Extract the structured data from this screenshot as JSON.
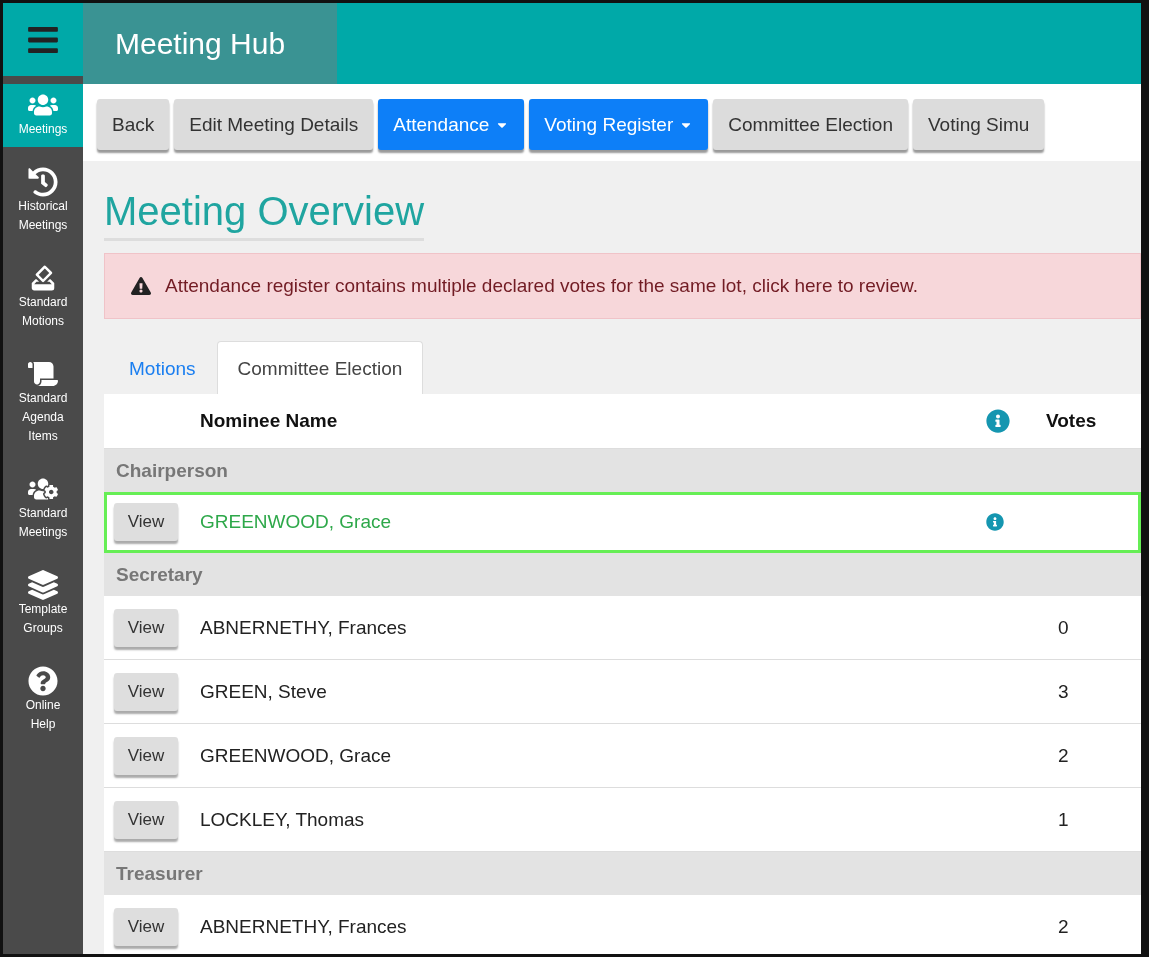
{
  "header": {
    "title": "Meeting Hub"
  },
  "sidebar": {
    "items": [
      {
        "label": "Meetings",
        "kind": "people",
        "selected": true
      },
      {
        "label": "Historical Meetings",
        "kind": "history",
        "selected": false
      },
      {
        "label": "Standard Motions",
        "kind": "ballot",
        "selected": false
      },
      {
        "label": "Standard Agenda Items",
        "kind": "scroll",
        "selected": false
      },
      {
        "label": "Standard Meetings",
        "kind": "peoplegear",
        "selected": false
      },
      {
        "label": "Template Groups",
        "kind": "layers",
        "selected": false
      },
      {
        "label": "Online Help",
        "kind": "help",
        "selected": false
      }
    ]
  },
  "toolbar": [
    {
      "label": "Back",
      "kind": "plain"
    },
    {
      "label": "Edit Meeting Details",
      "kind": "plain"
    },
    {
      "label": "Attendance",
      "kind": "dropdown"
    },
    {
      "label": "Voting Register",
      "kind": "dropdown"
    },
    {
      "label": "Committee Election",
      "kind": "plain"
    },
    {
      "label": "Voting Simu",
      "kind": "plain"
    }
  ],
  "page_title": "Meeting Overview",
  "alert": {
    "text": "Attendance register contains multiple declared votes for the same lot, click here to review."
  },
  "tabs": [
    {
      "label": "Motions",
      "selected": false
    },
    {
      "label": "Committee Election",
      "selected": true
    }
  ],
  "table": {
    "columns": [
      "Nominee Name",
      "Votes"
    ],
    "groups": [
      {
        "name": "Chairperson",
        "rows": [
          {
            "button": "View",
            "name": "GREENWOOD, Grace",
            "elected": true
          }
        ]
      },
      {
        "name": "Secretary",
        "rows": [
          {
            "button": "View",
            "name": "ABNERNETHY, Frances",
            "elected": false,
            "votes": "0"
          },
          {
            "button": "View",
            "name": "GREEN, Steve",
            "elected": false,
            "votes": "3"
          },
          {
            "button": "View",
            "name": "GREENWOOD, Grace",
            "elected": false,
            "votes": "2"
          },
          {
            "button": "View",
            "name": "LOCKLEY, Thomas",
            "elected": false,
            "votes": "1"
          }
        ]
      },
      {
        "name": "Treasurer",
        "rows": [
          {
            "button": "View",
            "name": "ABNERNETHY, Frances",
            "elected": false,
            "votes": "2"
          }
        ]
      }
    ]
  }
}
